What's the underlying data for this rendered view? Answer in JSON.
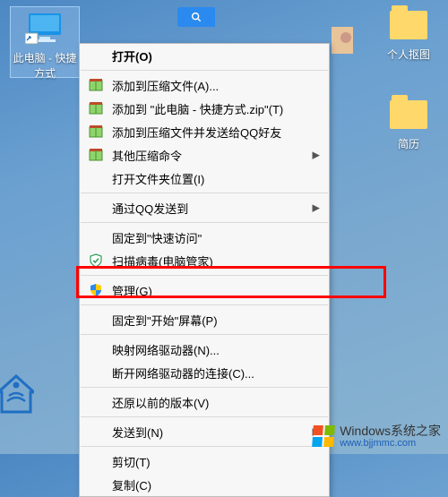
{
  "desktop": {
    "selected_icon_label": "此电脑 - 快捷方式",
    "icon_right_top_label": "个人抠图",
    "icon_right_mid_label": "简历",
    "icon_right_face_label": ""
  },
  "context_menu": {
    "open": "打开(O)",
    "add_archive": "添加到压缩文件(A)...",
    "add_archive_named": "添加到 \"此电脑 - 快捷方式.zip\"(T)",
    "add_send_qq": "添加到压缩文件并发送给QQ好友",
    "other_compress": "其他压缩命令",
    "open_file_location": "打开文件夹位置(I)",
    "send_via_qq": "通过QQ发送到",
    "pin_quick_access": "固定到\"快速访问\"",
    "scan_virus": "扫描病毒(电脑管家)",
    "manage": "管理(G)",
    "pin_start": "固定到\"开始\"屏幕(P)",
    "map_drive": "映射网络驱动器(N)...",
    "disconnect_drive": "断开网络驱动器的连接(C)...",
    "restore_versions": "还原以前的版本(V)",
    "send_to": "发送到(N)",
    "cut": "剪切(T)",
    "copy": "复制(C)"
  },
  "watermark": {
    "title": "Windows系统之家",
    "url": "www.bjjmmc.com"
  }
}
